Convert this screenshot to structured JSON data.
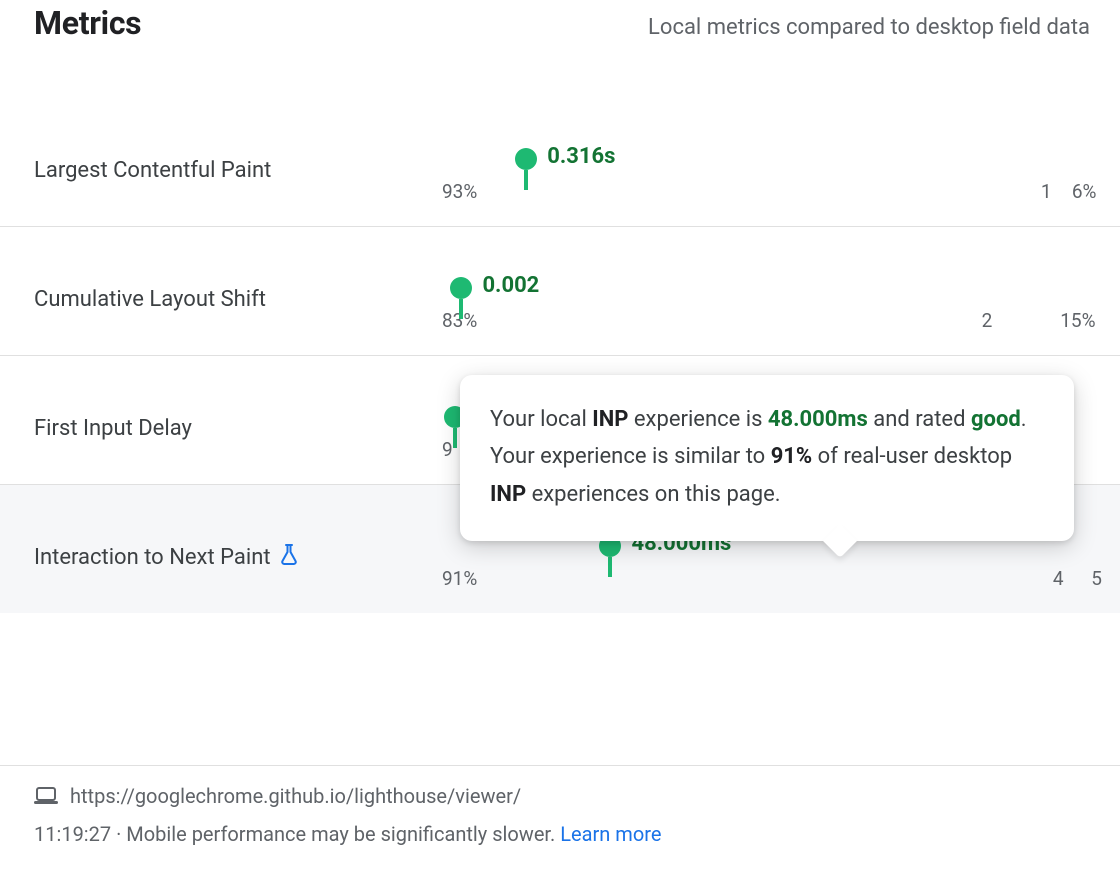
{
  "header": {
    "title": "Metrics",
    "subtitle": "Local metrics compared to desktop field data"
  },
  "metrics": [
    {
      "name": "Largest Contentful Paint",
      "value": "0.316s",
      "marker_pos_pct": 13,
      "segments": [
        {
          "kind": "good",
          "pct": 91.5,
          "label": "93%",
          "label_align": "left"
        },
        {
          "kind": "mid2",
          "pct": 1.5,
          "label": "1",
          "label_align": "right"
        },
        {
          "kind": "bad2",
          "pct": 6,
          "label": "6%",
          "label_align": "right"
        }
      ],
      "experimental": false
    },
    {
      "name": "Cumulative Layout Shift",
      "value": "0.002",
      "marker_pos_pct": 3,
      "segments": [
        {
          "kind": "good",
          "pct": 82,
          "label": "83%",
          "label_align": "left"
        },
        {
          "kind": "mid2",
          "pct": 2,
          "label": "2",
          "label_align": "right"
        },
        {
          "kind": "bad2",
          "pct": 15,
          "label": "15%",
          "label_align": "right"
        }
      ],
      "experimental": false
    },
    {
      "name": "First Input Delay",
      "value": "",
      "marker_pos_pct": 2,
      "segments": [
        {
          "kind": "good",
          "pct": 99,
          "label": "9",
          "label_align": "left"
        }
      ],
      "experimental": false
    },
    {
      "name": "Interaction to Next Paint",
      "value": "48.000ms",
      "marker_pos_pct": 26,
      "segments": [
        {
          "kind": "good",
          "pct": 91,
          "label": "91%",
          "label_align": "left"
        },
        {
          "kind": "mid",
          "pct": 4,
          "label": "4",
          "label_align": "right"
        },
        {
          "kind": "bad",
          "pct": 5,
          "label": "5",
          "label_align": "right"
        }
      ],
      "experimental": true,
      "selected": true
    }
  ],
  "tooltip": {
    "prefix": "Your local ",
    "metric_abbr": "INP",
    "mid1": " experience is ",
    "value": "48.000ms",
    "mid2": " and rated ",
    "rating": "good",
    "mid3": ". Your experience is similar to ",
    "percent": "91%",
    "mid4": " of real-user desktop ",
    "metric_abbr2": "INP",
    "suffix": " experiences on this page."
  },
  "footer": {
    "url": "https://googlechrome.github.io/lighthouse/viewer/",
    "time": "11:19:27",
    "sep": "  ·  ",
    "note": "Mobile performance may be significantly slower. ",
    "learn": "Learn more"
  }
}
